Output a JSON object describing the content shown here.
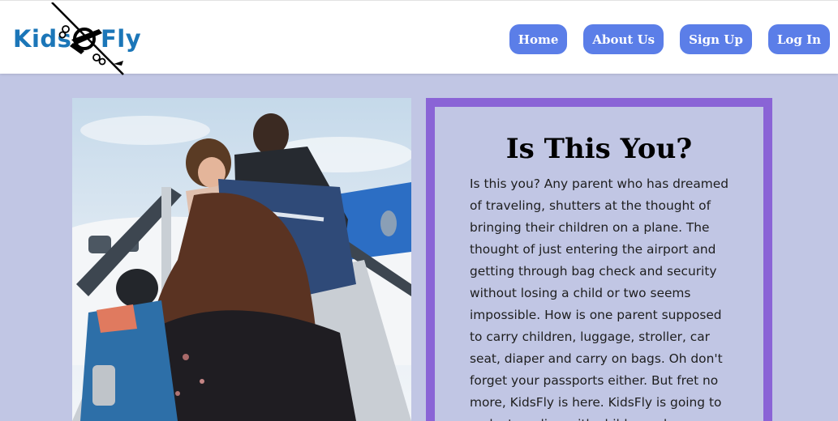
{
  "header": {
    "logo": {
      "word_left": "Kids",
      "word_right": "Fly"
    },
    "nav": [
      {
        "label": "Home"
      },
      {
        "label": "About Us"
      },
      {
        "label": "Sign Up"
      },
      {
        "label": "Log In"
      }
    ]
  },
  "hero_image": {
    "alt": "Family boarding an airplane up the stairs"
  },
  "card": {
    "title": "Is This You?",
    "body": "Is this you? Any parent who has dreamed of traveling, shutters at the thought of bringing their children on a plane. The thought of just entering the airport and getting through bag check and security without losing a child or two seems impossible. How is one parent supposed to carry children, luggage, stroller, car seat, diaper and carry on bags. Oh don't forget your passports either. But fret no more, KidsFly is here. KidsFly is going to make traveling with children a breeze"
  },
  "colors": {
    "page_bg": "#c1c6e4",
    "header_bg": "#ffffff",
    "nav_button": "#5b7ee8",
    "card_border": "#8a64d6",
    "logo_blue": "#1b76b8"
  }
}
